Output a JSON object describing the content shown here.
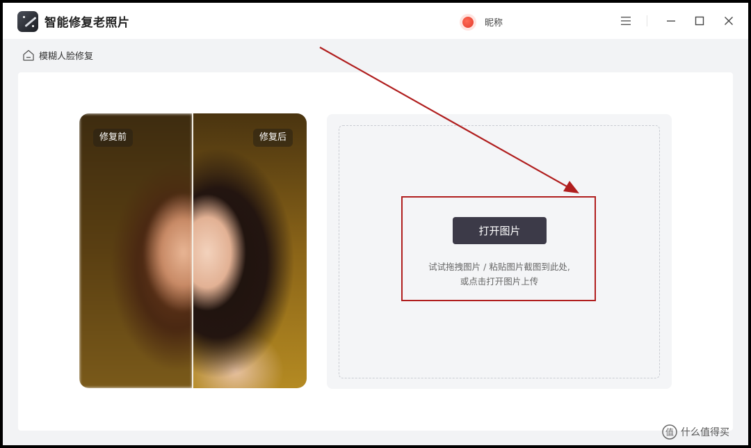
{
  "window": {
    "title": "智能修复老照片",
    "nickname": "昵称"
  },
  "breadcrumb": {
    "label": "模糊人脸修复"
  },
  "sample": {
    "before_tag": "修复前",
    "after_tag": "修复后"
  },
  "upload": {
    "button_label": "打开图片",
    "hint_line1": "试试拖拽图片 / 粘贴图片截图到此处,",
    "hint_line2": "或点击打开图片上传"
  },
  "watermark": {
    "text": "什么值得买"
  },
  "colors": {
    "accent_button": "#3c3a48",
    "annotation": "#b01e1e",
    "page_bg": "#f2f3f5"
  }
}
